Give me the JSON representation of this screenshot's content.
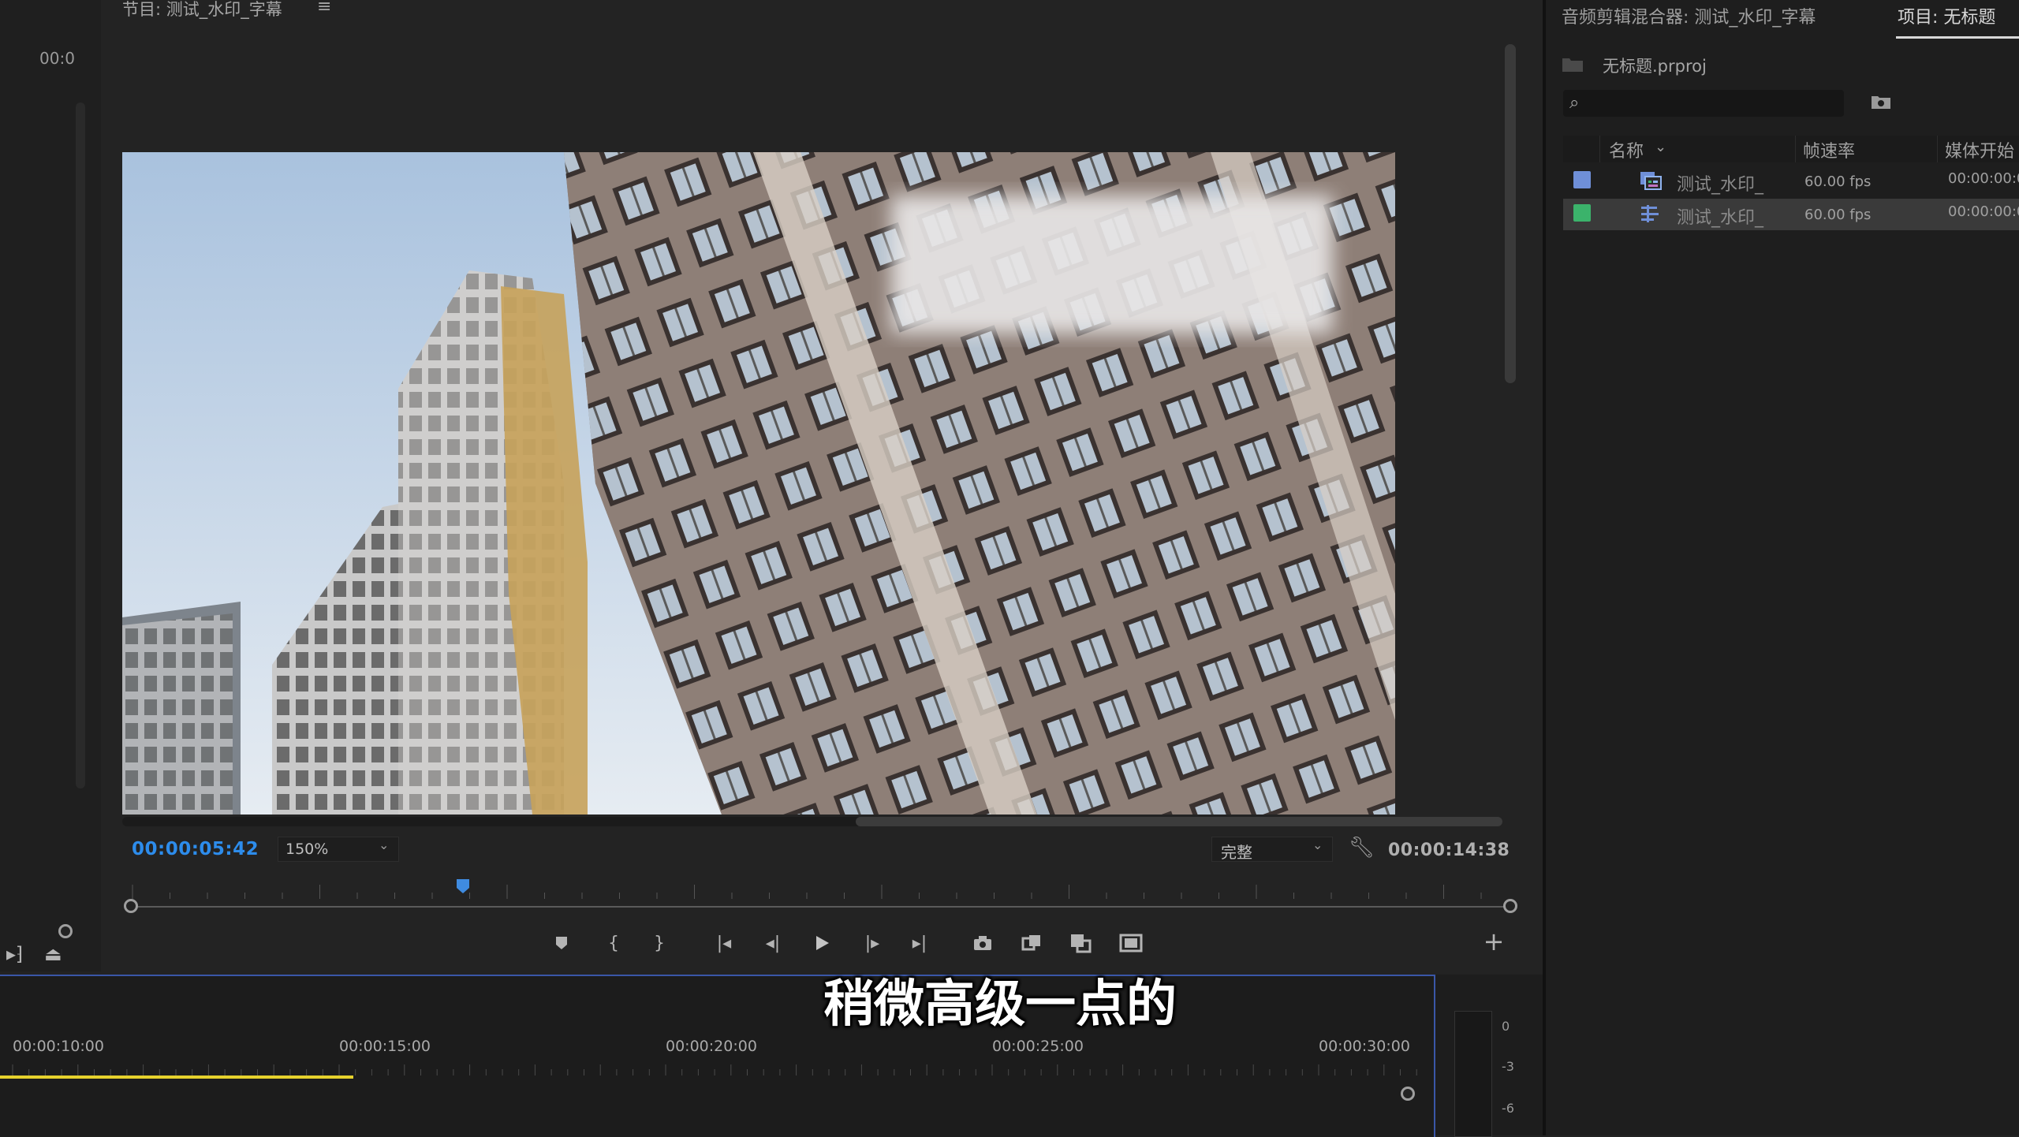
{
  "left_panel": {
    "timecode": "00:0"
  },
  "program_monitor": {
    "title": "节目: 测试_水印_字幕",
    "menu_icon": "≡",
    "current_time": "00:00:05:42",
    "zoom": "150%",
    "quality": "完整",
    "duration": "00:00:14:38",
    "playhead_fraction": 0.24
  },
  "transport": {
    "icons": [
      "marker-icon",
      "mark-in-icon",
      "mark-out-icon",
      "go-to-in-icon",
      "step-back-icon",
      "play-icon",
      "step-forward-icon",
      "go-to-out-icon",
      "camera-icon",
      "export-frame-icon",
      "overlay-icon",
      "safe-margins-icon"
    ],
    "add_label": "+"
  },
  "timeline": {
    "labels": [
      "00:00:10:00",
      "00:00:15:00",
      "00:00:20:00",
      "00:00:25:00",
      "00:00:30:00"
    ],
    "accent": "#e6d22d"
  },
  "subtitle": {
    "text": "稍微高级一点的"
  },
  "audio_meter": {
    "labels": [
      "0",
      "-3",
      "-6"
    ]
  },
  "right_panel": {
    "audio_mixer_tab": "音频剪辑混合器: 测试_水印_字幕",
    "project_tab": "项目: 无标题",
    "project_file": "无标题.prproj",
    "search": {
      "placeholder": ""
    },
    "columns": {
      "name": "名称",
      "fps": "帧速率",
      "media_start": "媒体开始"
    },
    "items": [
      {
        "name": "测试_水印_",
        "fps": "60.00 fps",
        "start": "00:00:00:0",
        "color": "#6f8fd8",
        "icon": "sequence-icon"
      },
      {
        "name": "测试_水印_",
        "fps": "60.00 fps",
        "start": "00:00:00:0",
        "color": "#3bb36b",
        "icon": "clip-icon"
      }
    ]
  }
}
